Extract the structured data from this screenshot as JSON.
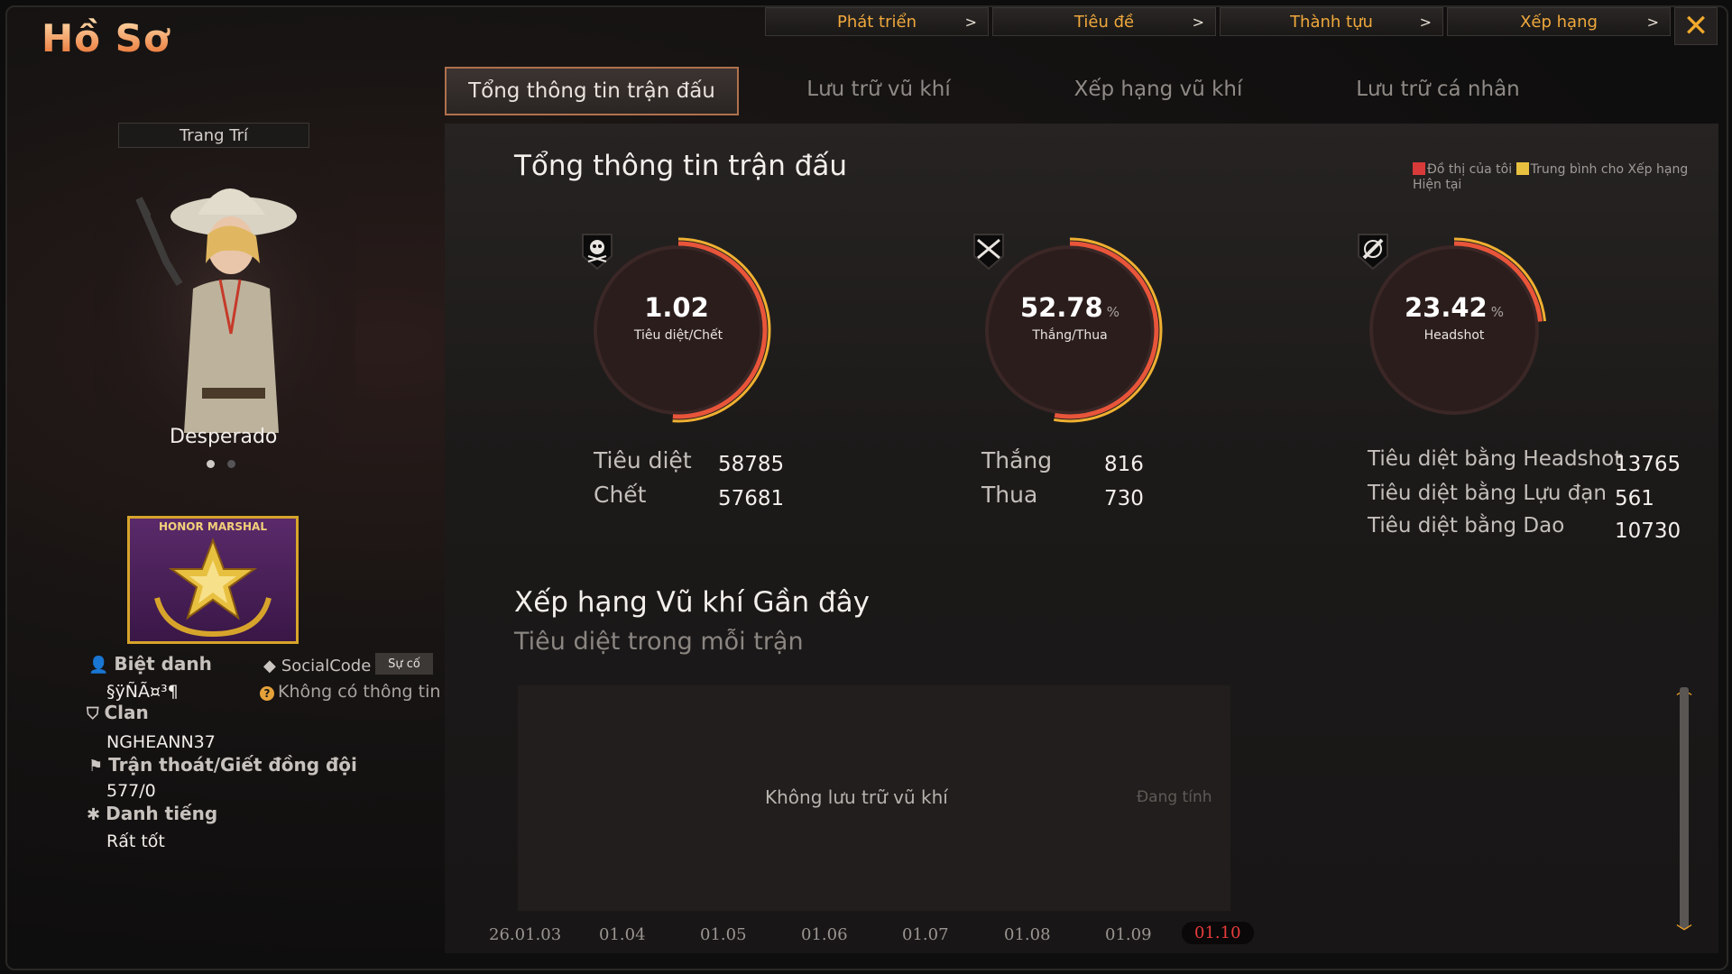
{
  "app": {
    "title": "Hồ Sơ"
  },
  "topnav": [
    {
      "label": "Phát triển"
    },
    {
      "label": "Tiêu đề"
    },
    {
      "label": "Thành tựu"
    },
    {
      "label": "Xếp hạng"
    }
  ],
  "tabs": [
    {
      "label": "Tổng thông tin trận đấu",
      "active": true
    },
    {
      "label": "Lưu trữ vũ khí",
      "active": false
    },
    {
      "label": "Xếp hạng vũ khí",
      "active": false
    },
    {
      "label": "Lưu trữ cá nhân",
      "active": false
    }
  ],
  "profile": {
    "decor_label": "Trang Trí",
    "character_name": "Desperado",
    "badge_text": "HONOR MARSHAL",
    "nickname_label": "Biệt danh",
    "nickname_value": "§ÿÑÃ¤³¶",
    "social_label": "SocialCode",
    "report_label": "Sự cố",
    "social_value": "Không có thông tin",
    "clan_label": "Clan",
    "clan_value": "NGHEANN37",
    "escape_label": "Trận thoát/Giết đồng đội",
    "escape_value": "577/0",
    "reputation_label": "Danh tiếng",
    "reputation_value": "Rất tốt"
  },
  "summary": {
    "title": "Tổng thông tin trận đấu",
    "legend_mine": "Đồ thị của tôi",
    "legend_avg": "Trung bình cho Xếp hạng Hiện tại",
    "gauges": [
      {
        "value": "1.02",
        "unit": "",
        "caption": "Tiêu diệt/Chết",
        "icon": "skull-icon",
        "fill": 0.51
      },
      {
        "value": "52.78",
        "unit": "%",
        "caption": "Thắng/Thua",
        "icon": "crossed-guns-icon",
        "fill": 0.5278
      },
      {
        "value": "23.42",
        "unit": "%",
        "caption": "Headshot",
        "icon": "knife-icon",
        "fill": 0.2342
      }
    ],
    "kd": [
      {
        "label": "Tiêu diệt",
        "value": "58785"
      },
      {
        "label": "Chết",
        "value": "57681"
      }
    ],
    "wl": [
      {
        "label": "Thắng",
        "value": "816"
      },
      {
        "label": "Thua",
        "value": "730"
      }
    ],
    "hs": [
      {
        "label": "Tiêu diệt bằng Headshot",
        "value": "13765"
      },
      {
        "label": "Tiêu diệt bằng Lựu đạn",
        "value": "561"
      },
      {
        "label": "Tiêu diệt bằng Dao",
        "value": "10730"
      }
    ]
  },
  "weapons": {
    "title": "Xếp hạng Vũ khí Gần đây",
    "subtitle": "Tiêu diệt trong mỗi trận",
    "empty_text": "Không lưu trữ vũ khí",
    "status_text": "Đang tính",
    "dates": [
      "26.01.03",
      "01.04",
      "01.05",
      "01.06",
      "01.07",
      "01.08",
      "01.09",
      "01.10"
    ],
    "selected_index": 7
  },
  "colors": {
    "accent": "#f0a83c",
    "gauge_arc": "#e8553a",
    "gauge_arc2": "#f0b030"
  }
}
